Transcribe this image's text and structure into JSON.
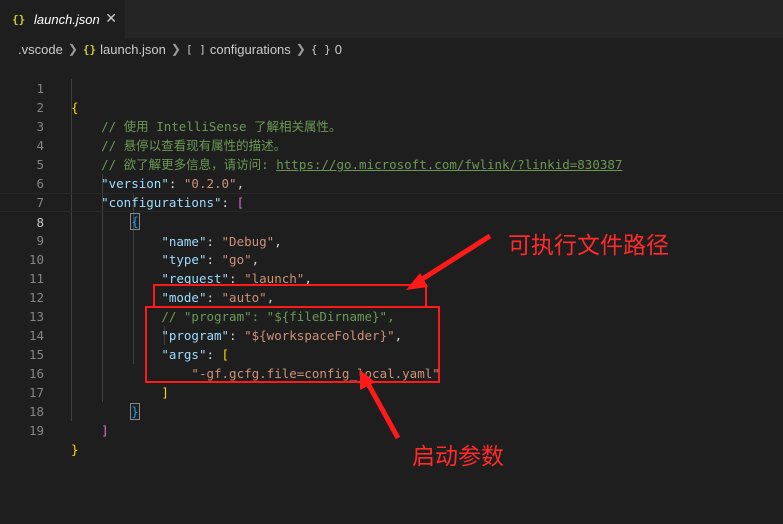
{
  "tab": {
    "icon": "{}",
    "label": "launch.json",
    "close": "✕"
  },
  "breadcrumb": {
    "items": [
      {
        "icon": "",
        "label": ".vscode"
      },
      {
        "icon": "{}",
        "label": "launch.json"
      },
      {
        "icon": "[ ]",
        "label": "configurations"
      },
      {
        "icon": "{ }",
        "label": "0"
      }
    ]
  },
  "editor": {
    "line_numbers": [
      "1",
      "2",
      "3",
      "4",
      "5",
      "6",
      "7",
      "8",
      "9",
      "10",
      "11",
      "12",
      "13",
      "14",
      "15",
      "16",
      "17",
      "18",
      "19"
    ],
    "active_line": "8",
    "lines": {
      "l1_brace": "{",
      "l2_comment": "// 使用 IntelliSense 了解相关属性。",
      "l3_comment": "// 悬停以查看现有属性的描述。",
      "l4_comment": "// 欲了解更多信息，请访问: ",
      "l4_url": "https://go.microsoft.com/fwlink/?linkid=830387",
      "l5_key": "\"version\"",
      "l5_val": "\"0.2.0\"",
      "l6_key": "\"configurations\"",
      "l6_bracket": "[",
      "l7_brace": "{",
      "l8_key": "\"name\"",
      "l8_val": "\"Debug\"",
      "l9_key": "\"type\"",
      "l9_val": "\"go\"",
      "l10_key": "\"request\"",
      "l10_val": "\"launch\"",
      "l11_key": "\"mode\"",
      "l11_val": "\"auto\"",
      "l12_comment": "// \"program\": \"${fileDirname}\",",
      "l13_key": "\"program\"",
      "l13_val": "\"${workspaceFolder}\"",
      "l14_key": "\"args\"",
      "l14_bracket": "[",
      "l15_val": "\"-gf.gcfg.file=config_local.yaml\"",
      "l16_bracket": "]",
      "l17_brace": "}",
      "l18_bracket": "]",
      "l19_brace": "}"
    }
  },
  "annotations": {
    "program_label": "可执行文件路径",
    "args_label": "启动参数",
    "color": "#ff1a1a"
  },
  "colors": {
    "background": "#1e1e1e",
    "key": "#9cdcfe",
    "string": "#ce9178",
    "comment": "#6a9955",
    "bracket_gold": "#ffd700",
    "bracket_purple": "#da70d6",
    "bracket_blue": "#179fff"
  }
}
